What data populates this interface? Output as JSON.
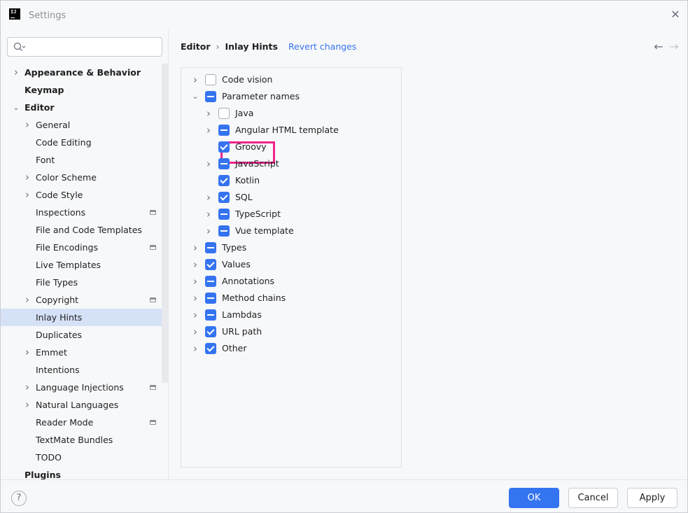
{
  "window": {
    "title": "Settings"
  },
  "search": {
    "placeholder": ""
  },
  "sidebar": {
    "items": [
      {
        "label": "Appearance & Behavior",
        "level": 0,
        "bold": true,
        "chevron": "right"
      },
      {
        "label": "Keymap",
        "level": 0,
        "bold": true,
        "chevron": ""
      },
      {
        "label": "Editor",
        "level": 0,
        "bold": true,
        "chevron": "down"
      },
      {
        "label": "General",
        "level": 1,
        "bold": false,
        "chevron": "right"
      },
      {
        "label": "Code Editing",
        "level": 1,
        "bold": false,
        "chevron": ""
      },
      {
        "label": "Font",
        "level": 1,
        "bold": false,
        "chevron": ""
      },
      {
        "label": "Color Scheme",
        "level": 1,
        "bold": false,
        "chevron": "right"
      },
      {
        "label": "Code Style",
        "level": 1,
        "bold": false,
        "chevron": "right"
      },
      {
        "label": "Inspections",
        "level": 1,
        "bold": false,
        "chevron": "",
        "project_icon": true
      },
      {
        "label": "File and Code Templates",
        "level": 1,
        "bold": false,
        "chevron": ""
      },
      {
        "label": "File Encodings",
        "level": 1,
        "bold": false,
        "chevron": "",
        "project_icon": true
      },
      {
        "label": "Live Templates",
        "level": 1,
        "bold": false,
        "chevron": ""
      },
      {
        "label": "File Types",
        "level": 1,
        "bold": false,
        "chevron": ""
      },
      {
        "label": "Copyright",
        "level": 1,
        "bold": false,
        "chevron": "right",
        "project_icon": true
      },
      {
        "label": "Inlay Hints",
        "level": 1,
        "bold": false,
        "chevron": "",
        "selected": true
      },
      {
        "label": "Duplicates",
        "level": 1,
        "bold": false,
        "chevron": ""
      },
      {
        "label": "Emmet",
        "level": 1,
        "bold": false,
        "chevron": "right"
      },
      {
        "label": "Intentions",
        "level": 1,
        "bold": false,
        "chevron": ""
      },
      {
        "label": "Language Injections",
        "level": 1,
        "bold": false,
        "chevron": "right",
        "project_icon": true
      },
      {
        "label": "Natural Languages",
        "level": 1,
        "bold": false,
        "chevron": "right"
      },
      {
        "label": "Reader Mode",
        "level": 1,
        "bold": false,
        "chevron": "",
        "project_icon": true
      },
      {
        "label": "TextMate Bundles",
        "level": 1,
        "bold": false,
        "chevron": ""
      },
      {
        "label": "TODO",
        "level": 1,
        "bold": false,
        "chevron": ""
      },
      {
        "label": "Plugins",
        "level": 0,
        "bold": true,
        "chevron": ""
      }
    ]
  },
  "breadcrumb": {
    "parent": "Editor",
    "separator": "›",
    "current": "Inlay Hints",
    "revert": "Revert changes"
  },
  "hints": [
    {
      "label": "Code vision",
      "level": 0,
      "chevron": "right",
      "state": "unchecked"
    },
    {
      "label": "Parameter names",
      "level": 0,
      "chevron": "down",
      "state": "partial"
    },
    {
      "label": "Java",
      "level": 1,
      "chevron": "right",
      "state": "unchecked"
    },
    {
      "label": "Angular HTML template",
      "level": 1,
      "chevron": "right",
      "state": "partial"
    },
    {
      "label": "Groovy",
      "level": 1,
      "chevron": "",
      "state": "checked"
    },
    {
      "label": "JavaScript",
      "level": 1,
      "chevron": "right",
      "state": "partial"
    },
    {
      "label": "Kotlin",
      "level": 1,
      "chevron": "",
      "state": "checked"
    },
    {
      "label": "SQL",
      "level": 1,
      "chevron": "right",
      "state": "checked"
    },
    {
      "label": "TypeScript",
      "level": 1,
      "chevron": "right",
      "state": "partial"
    },
    {
      "label": "Vue template",
      "level": 1,
      "chevron": "right",
      "state": "partial"
    },
    {
      "label": "Types",
      "level": 0,
      "chevron": "right",
      "state": "partial"
    },
    {
      "label": "Values",
      "level": 0,
      "chevron": "right",
      "state": "checked"
    },
    {
      "label": "Annotations",
      "level": 0,
      "chevron": "right",
      "state": "partial"
    },
    {
      "label": "Method chains",
      "level": 0,
      "chevron": "right",
      "state": "partial"
    },
    {
      "label": "Lambdas",
      "level": 0,
      "chevron": "right",
      "state": "partial"
    },
    {
      "label": "URL path",
      "level": 0,
      "chevron": "right",
      "state": "checked"
    },
    {
      "label": "Other",
      "level": 0,
      "chevron": "right",
      "state": "checked"
    }
  ],
  "footer": {
    "help": "?",
    "ok": "OK",
    "cancel": "Cancel",
    "apply": "Apply"
  },
  "colors": {
    "accent": "#3574f0",
    "selection": "#d5e1f7",
    "highlight": "#f0248b"
  }
}
